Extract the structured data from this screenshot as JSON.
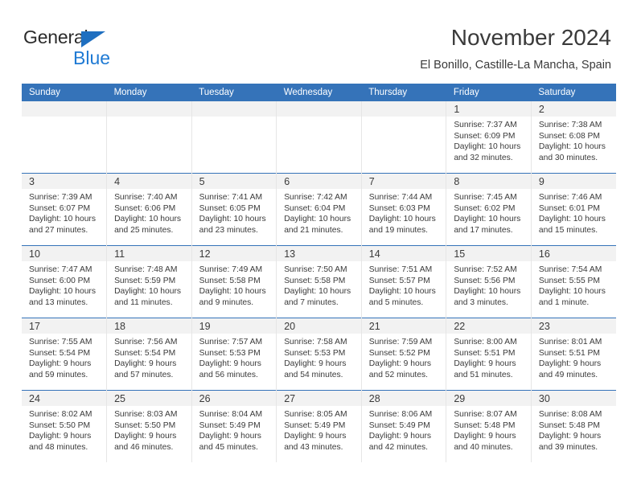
{
  "brand": {
    "name_part1": "General",
    "name_part2": "Blue",
    "triangle_color": "#1f6fc0",
    "blue_color": "#1f7ad4"
  },
  "header": {
    "title": "November 2024",
    "subtitle": "El Bonillo, Castille-La Mancha, Spain"
  },
  "colors": {
    "header_row_bg": "#3573b9",
    "header_row_text": "#ffffff",
    "daynum_bg": "#f2f2f2",
    "cell_text": "#3a3a3a",
    "grid_line": "#e6e6e6"
  },
  "weekdays": [
    "Sunday",
    "Monday",
    "Tuesday",
    "Wednesday",
    "Thursday",
    "Friday",
    "Saturday"
  ],
  "weeks": [
    [
      {
        "empty": true
      },
      {
        "empty": true
      },
      {
        "empty": true
      },
      {
        "empty": true
      },
      {
        "empty": true
      },
      {
        "day": "1",
        "sunrise": "Sunrise: 7:37 AM",
        "sunset": "Sunset: 6:09 PM",
        "daylight1": "Daylight: 10 hours",
        "daylight2": "and 32 minutes."
      },
      {
        "day": "2",
        "sunrise": "Sunrise: 7:38 AM",
        "sunset": "Sunset: 6:08 PM",
        "daylight1": "Daylight: 10 hours",
        "daylight2": "and 30 minutes."
      }
    ],
    [
      {
        "day": "3",
        "sunrise": "Sunrise: 7:39 AM",
        "sunset": "Sunset: 6:07 PM",
        "daylight1": "Daylight: 10 hours",
        "daylight2": "and 27 minutes."
      },
      {
        "day": "4",
        "sunrise": "Sunrise: 7:40 AM",
        "sunset": "Sunset: 6:06 PM",
        "daylight1": "Daylight: 10 hours",
        "daylight2": "and 25 minutes."
      },
      {
        "day": "5",
        "sunrise": "Sunrise: 7:41 AM",
        "sunset": "Sunset: 6:05 PM",
        "daylight1": "Daylight: 10 hours",
        "daylight2": "and 23 minutes."
      },
      {
        "day": "6",
        "sunrise": "Sunrise: 7:42 AM",
        "sunset": "Sunset: 6:04 PM",
        "daylight1": "Daylight: 10 hours",
        "daylight2": "and 21 minutes."
      },
      {
        "day": "7",
        "sunrise": "Sunrise: 7:44 AM",
        "sunset": "Sunset: 6:03 PM",
        "daylight1": "Daylight: 10 hours",
        "daylight2": "and 19 minutes."
      },
      {
        "day": "8",
        "sunrise": "Sunrise: 7:45 AM",
        "sunset": "Sunset: 6:02 PM",
        "daylight1": "Daylight: 10 hours",
        "daylight2": "and 17 minutes."
      },
      {
        "day": "9",
        "sunrise": "Sunrise: 7:46 AM",
        "sunset": "Sunset: 6:01 PM",
        "daylight1": "Daylight: 10 hours",
        "daylight2": "and 15 minutes."
      }
    ],
    [
      {
        "day": "10",
        "sunrise": "Sunrise: 7:47 AM",
        "sunset": "Sunset: 6:00 PM",
        "daylight1": "Daylight: 10 hours",
        "daylight2": "and 13 minutes."
      },
      {
        "day": "11",
        "sunrise": "Sunrise: 7:48 AM",
        "sunset": "Sunset: 5:59 PM",
        "daylight1": "Daylight: 10 hours",
        "daylight2": "and 11 minutes."
      },
      {
        "day": "12",
        "sunrise": "Sunrise: 7:49 AM",
        "sunset": "Sunset: 5:58 PM",
        "daylight1": "Daylight: 10 hours",
        "daylight2": "and 9 minutes."
      },
      {
        "day": "13",
        "sunrise": "Sunrise: 7:50 AM",
        "sunset": "Sunset: 5:58 PM",
        "daylight1": "Daylight: 10 hours",
        "daylight2": "and 7 minutes."
      },
      {
        "day": "14",
        "sunrise": "Sunrise: 7:51 AM",
        "sunset": "Sunset: 5:57 PM",
        "daylight1": "Daylight: 10 hours",
        "daylight2": "and 5 minutes."
      },
      {
        "day": "15",
        "sunrise": "Sunrise: 7:52 AM",
        "sunset": "Sunset: 5:56 PM",
        "daylight1": "Daylight: 10 hours",
        "daylight2": "and 3 minutes."
      },
      {
        "day": "16",
        "sunrise": "Sunrise: 7:54 AM",
        "sunset": "Sunset: 5:55 PM",
        "daylight1": "Daylight: 10 hours",
        "daylight2": "and 1 minute."
      }
    ],
    [
      {
        "day": "17",
        "sunrise": "Sunrise: 7:55 AM",
        "sunset": "Sunset: 5:54 PM",
        "daylight1": "Daylight: 9 hours",
        "daylight2": "and 59 minutes."
      },
      {
        "day": "18",
        "sunrise": "Sunrise: 7:56 AM",
        "sunset": "Sunset: 5:54 PM",
        "daylight1": "Daylight: 9 hours",
        "daylight2": "and 57 minutes."
      },
      {
        "day": "19",
        "sunrise": "Sunrise: 7:57 AM",
        "sunset": "Sunset: 5:53 PM",
        "daylight1": "Daylight: 9 hours",
        "daylight2": "and 56 minutes."
      },
      {
        "day": "20",
        "sunrise": "Sunrise: 7:58 AM",
        "sunset": "Sunset: 5:53 PM",
        "daylight1": "Daylight: 9 hours",
        "daylight2": "and 54 minutes."
      },
      {
        "day": "21",
        "sunrise": "Sunrise: 7:59 AM",
        "sunset": "Sunset: 5:52 PM",
        "daylight1": "Daylight: 9 hours",
        "daylight2": "and 52 minutes."
      },
      {
        "day": "22",
        "sunrise": "Sunrise: 8:00 AM",
        "sunset": "Sunset: 5:51 PM",
        "daylight1": "Daylight: 9 hours",
        "daylight2": "and 51 minutes."
      },
      {
        "day": "23",
        "sunrise": "Sunrise: 8:01 AM",
        "sunset": "Sunset: 5:51 PM",
        "daylight1": "Daylight: 9 hours",
        "daylight2": "and 49 minutes."
      }
    ],
    [
      {
        "day": "24",
        "sunrise": "Sunrise: 8:02 AM",
        "sunset": "Sunset: 5:50 PM",
        "daylight1": "Daylight: 9 hours",
        "daylight2": "and 48 minutes."
      },
      {
        "day": "25",
        "sunrise": "Sunrise: 8:03 AM",
        "sunset": "Sunset: 5:50 PM",
        "daylight1": "Daylight: 9 hours",
        "daylight2": "and 46 minutes."
      },
      {
        "day": "26",
        "sunrise": "Sunrise: 8:04 AM",
        "sunset": "Sunset: 5:49 PM",
        "daylight1": "Daylight: 9 hours",
        "daylight2": "and 45 minutes."
      },
      {
        "day": "27",
        "sunrise": "Sunrise: 8:05 AM",
        "sunset": "Sunset: 5:49 PM",
        "daylight1": "Daylight: 9 hours",
        "daylight2": "and 43 minutes."
      },
      {
        "day": "28",
        "sunrise": "Sunrise: 8:06 AM",
        "sunset": "Sunset: 5:49 PM",
        "daylight1": "Daylight: 9 hours",
        "daylight2": "and 42 minutes."
      },
      {
        "day": "29",
        "sunrise": "Sunrise: 8:07 AM",
        "sunset": "Sunset: 5:48 PM",
        "daylight1": "Daylight: 9 hours",
        "daylight2": "and 40 minutes."
      },
      {
        "day": "30",
        "sunrise": "Sunrise: 8:08 AM",
        "sunset": "Sunset: 5:48 PM",
        "daylight1": "Daylight: 9 hours",
        "daylight2": "and 39 minutes."
      }
    ]
  ]
}
